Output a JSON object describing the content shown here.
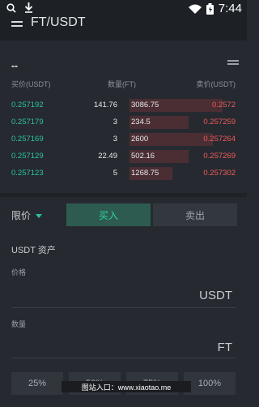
{
  "status_bar": {
    "time": "7:44"
  },
  "title_bar": {
    "title": "FT/USDT"
  },
  "ticker": {
    "last_price": "--"
  },
  "orderbook": {
    "headers": {
      "buy_price": "买价(USDT)",
      "quantity": "数量(FT)",
      "sell_price": "卖价(USDT)"
    },
    "rows": [
      {
        "buy_price": "0.257192",
        "buy_qty": "141.76",
        "sell_qty": "3086.75",
        "sell_price": "0.2572",
        "depth": 0.87
      },
      {
        "buy_price": "0.257179",
        "buy_qty": "3",
        "sell_qty": "234.5",
        "sell_price": "0.257259",
        "depth": 0.55
      },
      {
        "buy_price": "0.257169",
        "buy_qty": "3",
        "sell_qty": "2600",
        "sell_price": "0.257264",
        "depth": 0.78
      },
      {
        "buy_price": "0.257129",
        "buy_qty": "22.49",
        "sell_qty": "502.16",
        "sell_price": "0.257269",
        "depth": 0.55
      },
      {
        "buy_price": "0.257123",
        "buy_qty": "5",
        "sell_qty": "1268.75",
        "sell_price": "0.257302",
        "depth": 0.4
      }
    ]
  },
  "trade": {
    "order_type": "限价",
    "buy_tab": "买入",
    "sell_tab": "卖出",
    "asset_label": "USDT  资产",
    "price_label": "价格",
    "price_unit": "USDT",
    "qty_label": "数量",
    "qty_unit": "FT",
    "percents": [
      "25%",
      "50%",
      "75%",
      "100%"
    ]
  },
  "watermark": "图站入口：www.xiaotao.me",
  "colors": {
    "buy": "#2cc29a",
    "sell": "#ee5a5a",
    "background": "#262a30"
  }
}
